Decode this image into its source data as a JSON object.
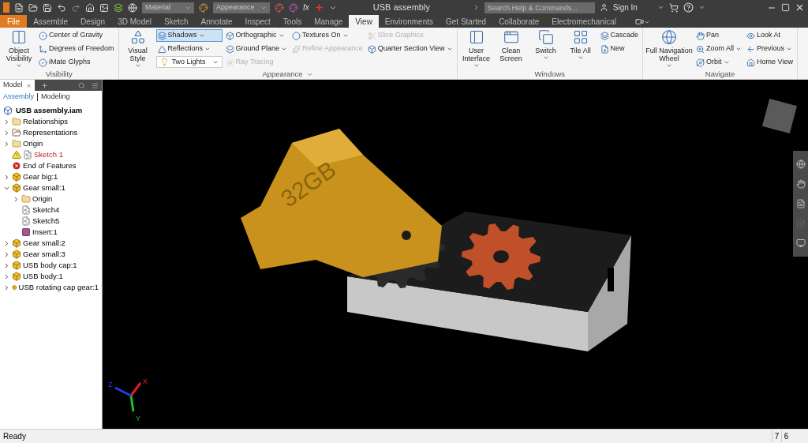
{
  "quick_access": {
    "material_placeholder": "Material",
    "appearance_placeholder": "Appearance",
    "function_symbol": "fx"
  },
  "window": {
    "title": "USB assembly"
  },
  "search": {
    "placeholder": "Search Help & Commands..."
  },
  "account": {
    "label": "Sign In"
  },
  "tabs": [
    {
      "label": "File",
      "kind": "file"
    },
    {
      "label": "Assemble",
      "kind": "tab",
      "selected": false
    },
    {
      "label": "Design",
      "kind": "tab",
      "selected": false
    },
    {
      "label": "3D Model",
      "kind": "tab",
      "selected": false
    },
    {
      "label": "Sketch",
      "kind": "tab",
      "selected": false
    },
    {
      "label": "Annotate",
      "kind": "tab",
      "selected": false
    },
    {
      "label": "Inspect",
      "kind": "tab",
      "selected": false
    },
    {
      "label": "Tools",
      "kind": "tab",
      "selected": false
    },
    {
      "label": "Manage",
      "kind": "tab",
      "selected": false
    },
    {
      "label": "View",
      "kind": "tab",
      "selected": true
    },
    {
      "label": "Environments",
      "kind": "tab",
      "selected": false
    },
    {
      "label": "Get Started",
      "kind": "tab",
      "selected": false
    },
    {
      "label": "Collaborate",
      "kind": "tab",
      "selected": false
    },
    {
      "label": "Electromechanical",
      "kind": "tab",
      "selected": false
    }
  ],
  "ribbon": {
    "panels": [
      {
        "title": "Visibility",
        "menu": false,
        "columns": [
          [
            {
              "label": "Object Visibility",
              "kind": "large",
              "dropdown": true,
              "disabled": false
            }
          ],
          [
            {
              "label": "Center of Gravity",
              "kind": "small",
              "dropdown": false,
              "disabled": false
            },
            {
              "label": "Degrees of Freedom",
              "kind": "small",
              "dropdown": false,
              "disabled": false
            },
            {
              "label": "iMate Glyphs",
              "kind": "small",
              "dropdown": false,
              "disabled": false
            }
          ]
        ]
      },
      {
        "title": "Appearance",
        "menu": true,
        "columns": [
          [
            {
              "label": "Visual Style",
              "kind": "large",
              "dropdown": true,
              "disabled": false
            }
          ],
          [
            {
              "label": "Shadows",
              "kind": "toggle",
              "dropdown": true,
              "disabled": false,
              "on": true
            },
            {
              "label": "Reflections",
              "kind": "small",
              "dropdown": true,
              "disabled": false
            },
            {
              "label": "Two Lights",
              "kind": "combo",
              "dropdown": true,
              "disabled": false
            }
          ],
          [
            {
              "label": "Orthographic",
              "kind": "small",
              "dropdown": true,
              "disabled": false
            },
            {
              "label": "Ground Plane",
              "kind": "small",
              "dropdown": true,
              "disabled": false
            },
            {
              "label": "Ray Tracing",
              "kind": "small",
              "dropdown": false,
              "disabled": true
            }
          ],
          [
            {
              "label": "Textures On",
              "kind": "small",
              "dropdown": true,
              "disabled": false
            },
            {
              "label": "Refine Appearance",
              "kind": "small",
              "dropdown": false,
              "disabled": true
            }
          ],
          [
            {
              "label": "Slice Graphics",
              "kind": "small",
              "dropdown": false,
              "disabled": true
            },
            {
              "label": "Quarter Section View",
              "kind": "small",
              "dropdown": true,
              "disabled": false
            }
          ]
        ]
      },
      {
        "title": "Windows",
        "menu": false,
        "columns": [
          [
            {
              "label": "User Interface",
              "kind": "large",
              "dropdown": true,
              "disabled": false
            }
          ],
          [
            {
              "label": "Clean Screen",
              "kind": "large",
              "dropdown": false,
              "disabled": false
            }
          ],
          [
            {
              "label": "Switch",
              "kind": "large",
              "dropdown": true,
              "disabled": false
            }
          ],
          [
            {
              "label": "Tile All",
              "kind": "large",
              "dropdown": true,
              "disabled": false
            }
          ],
          [
            {
              "label": "Cascade",
              "kind": "small",
              "dropdown": false,
              "disabled": false
            },
            {
              "label": "New",
              "kind": "small",
              "dropdown": false,
              "disabled": false
            }
          ]
        ]
      },
      {
        "title": "Navigate",
        "menu": false,
        "columns": [
          [
            {
              "label": "Full Navigation Wheel",
              "kind": "large",
              "dropdown": true,
              "disabled": false
            }
          ],
          [
            {
              "label": "Pan",
              "kind": "small",
              "dropdown": false,
              "disabled": false
            },
            {
              "label": "Zoom All",
              "kind": "small",
              "dropdown": true,
              "disabled": false
            },
            {
              "label": "Orbit",
              "kind": "small",
              "dropdown": true,
              "disabled": false
            }
          ],
          [
            {
              "label": "Look At",
              "kind": "small",
              "dropdown": false,
              "disabled": false
            },
            {
              "label": "Previous",
              "kind": "small",
              "dropdown": true,
              "disabled": false
            },
            {
              "label": "Home View",
              "kind": "small",
              "dropdown": false,
              "disabled": false
            }
          ]
        ]
      }
    ]
  },
  "browser": {
    "tab": "Model",
    "modes": [
      {
        "label": "Assembly",
        "selected": true
      },
      {
        "label": "Modeling",
        "selected": false
      }
    ],
    "root": {
      "label": "USB assembly.iam",
      "kind": "assembly",
      "children": [
        {
          "label": "Relationships",
          "kind": "folder",
          "expanded": false
        },
        {
          "label": "Representations",
          "kind": "representations",
          "expanded": false
        },
        {
          "label": "Origin",
          "kind": "folder",
          "expanded": false
        },
        {
          "label": "Sketch 1",
          "kind": "sketch",
          "warning": true
        },
        {
          "label": "End of Features",
          "kind": "end"
        },
        {
          "label": "Gear big:1",
          "kind": "part",
          "expanded": false
        },
        {
          "label": "Gear small:1",
          "kind": "part",
          "expanded": true,
          "children": [
            {
              "label": "Origin",
              "kind": "folder",
              "expanded": false
            },
            {
              "label": "Sketch4",
              "kind": "sketch",
              "warning": false
            },
            {
              "label": "Sketch5",
              "kind": "sketch",
              "warning": false
            },
            {
              "label": "Insert:1",
              "kind": "insert"
            }
          ]
        },
        {
          "label": "Gear small:2",
          "kind": "part",
          "expanded": false
        },
        {
          "label": "Gear small:3",
          "kind": "part",
          "expanded": false
        },
        {
          "label": "USB body cap:1",
          "kind": "part",
          "expanded": false
        },
        {
          "label": "USB body:1",
          "kind": "part",
          "expanded": false
        },
        {
          "label": "USB rotating cap gear:1",
          "kind": "part",
          "expanded": false
        }
      ]
    }
  },
  "viewport": {
    "model_label": "32GB",
    "axes": [
      {
        "label": "X",
        "color": "#e02020"
      },
      {
        "label": "Y",
        "color": "#20c020"
      },
      {
        "label": "Z",
        "color": "#2040e0"
      }
    ]
  },
  "status_bar": {
    "message": "Ready",
    "counts": [
      "7",
      "6"
    ]
  }
}
